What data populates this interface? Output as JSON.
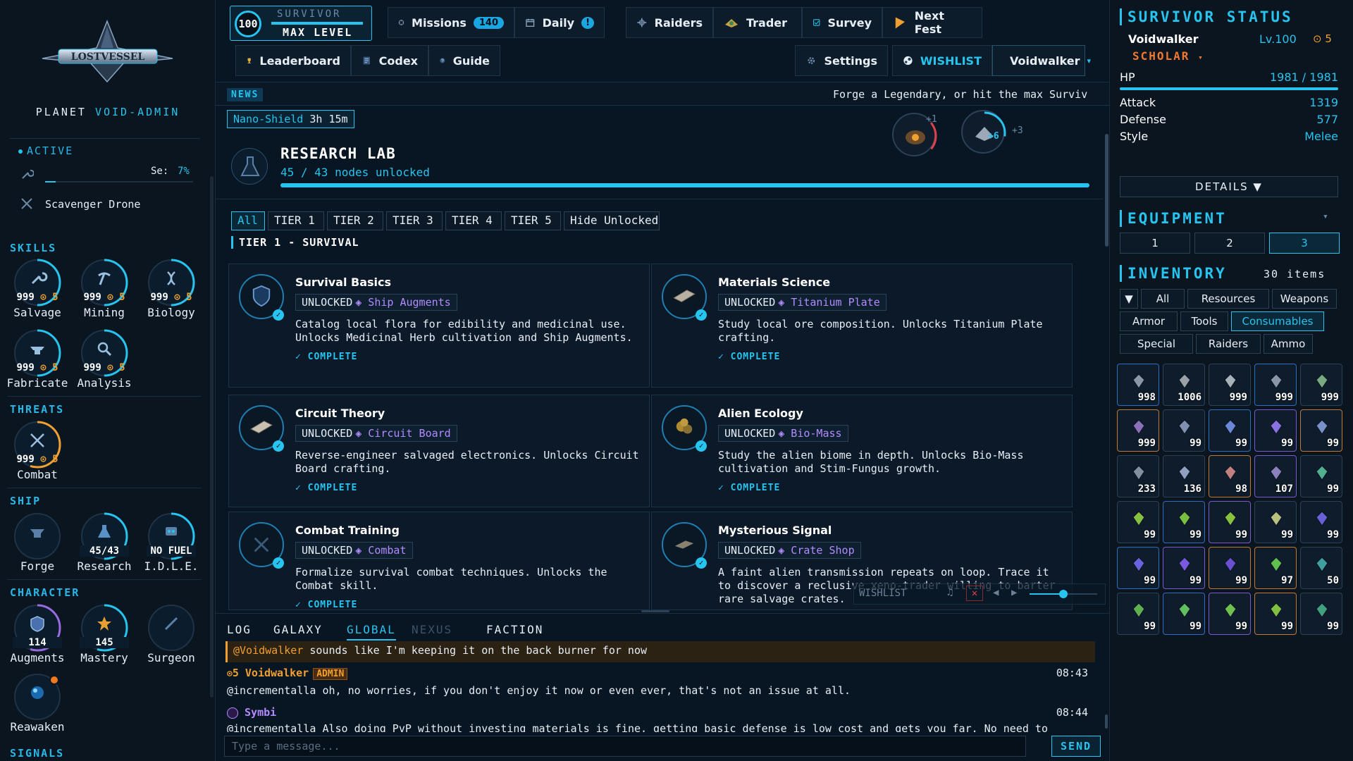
{
  "left": {
    "logo_text": "LOSTVESSEL",
    "planet_prefix": "PLANET",
    "planet_name": "VOID-ADMIN",
    "active_title": "ACTIVE",
    "active_task_label": "Se:",
    "active_task_pct": "7%",
    "active_task_progress": 0.07,
    "drone_label": "Scavenger Drone",
    "skills_title": "SKILLS",
    "skills": [
      {
        "name": "Salvage",
        "level": "999",
        "prestige": "5",
        "icon": "wrench-icon"
      },
      {
        "name": "Mining",
        "level": "999",
        "prestige": "5",
        "icon": "pickaxe-icon"
      },
      {
        "name": "Biology",
        "level": "999",
        "prestige": "5",
        "icon": "dna-icon"
      },
      {
        "name": "Fabricate",
        "level": "999",
        "prestige": "5",
        "icon": "anvil-icon"
      },
      {
        "name": "Analysis",
        "level": "999",
        "prestige": "5",
        "icon": "magnifier-icon"
      }
    ],
    "threats_title": "THREATS",
    "threats": [
      {
        "name": "Combat",
        "level": "999",
        "prestige": "5",
        "icon": "crossed-swords-icon"
      }
    ],
    "ship_title": "SHIP",
    "ship": [
      {
        "name": "Forge",
        "value": "",
        "icon": "forge-icon"
      },
      {
        "name": "Research",
        "value": "45/43",
        "icon": "flask-icon"
      },
      {
        "name": "I.D.L.E.",
        "value": "NO FUEL",
        "icon": "robot-icon"
      }
    ],
    "character_title": "CHARACTER",
    "character": [
      {
        "name": "Augments",
        "value": "114",
        "icon": "shield-chip-icon"
      },
      {
        "name": "Mastery",
        "value": "145",
        "icon": "star-badge-icon"
      },
      {
        "name": "Surgeon",
        "value": "",
        "icon": "scalpel-icon"
      },
      {
        "name": "Reawaken",
        "value": "",
        "icon": "orb-icon"
      }
    ],
    "signals_title": "SIGNALS"
  },
  "level": {
    "number": "100",
    "subtitle": "SURVIVOR",
    "title": "MAX LEVEL"
  },
  "nav": {
    "missions": "Missions",
    "missions_badge": "140",
    "daily": "Daily",
    "daily_badge": "!",
    "raiders": "Raiders",
    "trader": "Trader",
    "survey": "Survey",
    "next_fest": "Next Fest",
    "leaderboard": "Leaderboard",
    "codex": "Codex",
    "guide": "Guide",
    "settings": "Settings",
    "wishlist": "WISHLIST",
    "profile": "Voidwalker"
  },
  "news": {
    "tag": "NEWS",
    "text": "Forge a Legendary, or hit the max Surviv"
  },
  "buff": {
    "name": "Nano-Shield",
    "time": "3h 15m"
  },
  "floaters": {
    "a": "+1",
    "b": "+6",
    "c": "+3"
  },
  "lab": {
    "title": "RESEARCH LAB",
    "nodes": "45 / 43 nodes unlocked",
    "progress": 1.0
  },
  "tiers": [
    "All",
    "TIER 1",
    "TIER 2",
    "TIER 3",
    "TIER 4",
    "TIER 5",
    "Hide Unlocked"
  ],
  "tier_heading": "TIER 1 - SURVIVAL",
  "cards": [
    {
      "title": "Survival Basics",
      "unlock": "UNLOCKED",
      "reward": "Ship Augments",
      "desc": "Catalog local flora for edibility and medicinal use. Unlocks Medicinal Herb cultivation and Ship Augments.",
      "status": "✓ COMPLETE",
      "icon": "shield-icon"
    },
    {
      "title": "Materials Science",
      "unlock": "UNLOCKED",
      "reward": "Titanium Plate",
      "desc": "Study local ore composition. Unlocks Titanium Plate crafting.",
      "status": "✓ COMPLETE",
      "icon": "plate-icon"
    },
    {
      "title": "Circuit Theory",
      "unlock": "UNLOCKED",
      "reward": "Circuit Board",
      "desc": "Reverse-engineer salvaged electronics. Unlocks Circuit Board crafting.",
      "status": "✓ COMPLETE",
      "icon": "circuit-icon"
    },
    {
      "title": "Alien Ecology",
      "unlock": "UNLOCKED",
      "reward": "Bio-Mass",
      "desc": "Study the alien biome in depth. Unlocks Bio-Mass cultivation and Stim-Fungus growth.",
      "status": "✓ COMPLETE",
      "icon": "biomass-icon"
    },
    {
      "title": "Combat Training",
      "unlock": "UNLOCKED",
      "reward": "Combat",
      "desc": "Formalize survival combat techniques. Unlocks the Combat skill.",
      "status": "✓ COMPLETE",
      "icon": "crossed-swords-icon"
    },
    {
      "title": "Mysterious Signal",
      "unlock": "UNLOCKED",
      "reward": "Crate Shop",
      "desc": "A faint alien transmission repeats on loop. Trace it to discover a reclusive xeno-trader willing to barter rare salvage crates.",
      "status": "",
      "icon": "signal-icon"
    }
  ],
  "audio": {
    "label": "WISHLIST",
    "music": "♫",
    "mute": "✕",
    "prev": "◀",
    "next": "▶",
    "volume": 0.5
  },
  "chat": {
    "tabs": [
      "LOG",
      "GALAXY",
      "GLOBAL",
      "NEXUS",
      "FACTION"
    ],
    "mention_user": "@Voidwalker",
    "mention_text": " sounds like I'm keeping it on the back burner for now",
    "m2_prestige": "5",
    "m2_user": "Voidwalker",
    "m2_badge": "ADMIN",
    "m2_time": "08:43",
    "m2_text": "@incrementalla oh, no worries, if you don't enjoy it now or even ever, that's not an issue at all.",
    "m3_user": "Symbi",
    "m3_time": "08:44",
    "m3_text": "@incrementalla Also doing PvP without investing materials is fine, getting basic defense is low cost and gets you far. No need to",
    "placeholder": "Type a message...",
    "send": "SEND"
  },
  "status": {
    "title": "SURVIVOR STATUS",
    "name": "Voidwalker",
    "level": "Lv.100",
    "prestige": "5",
    "class": "SCHOLAR",
    "hp_label": "HP",
    "hp": "1981 / 1981",
    "hp_fraction": 1.0,
    "stats": [
      {
        "label": "Attack",
        "value": "1319"
      },
      {
        "label": "Defense",
        "value": "577"
      },
      {
        "label": "Style",
        "value": "Melee"
      }
    ],
    "details": "DETAILS ▼"
  },
  "equipment": {
    "title": "EQUIPMENT",
    "loadouts": [
      "1",
      "2",
      "3"
    ],
    "selected": "3"
  },
  "inventory": {
    "title": "INVENTORY",
    "count": "30 items",
    "filters": [
      "▼",
      "All",
      "Resources",
      "Weapons",
      "Armor",
      "Tools",
      "Consumables",
      "Special",
      "Raiders",
      "Ammo"
    ],
    "selected": "Consumables",
    "slots": [
      {
        "q": "998",
        "r": "rare",
        "c": "#8a96a8"
      },
      {
        "q": "1006",
        "r": "",
        "c": "#9aa0a8"
      },
      {
        "q": "999",
        "r": "",
        "c": "#a8b0b8"
      },
      {
        "q": "999",
        "r": "rare",
        "c": "#8a96a8"
      },
      {
        "q": "999",
        "r": "",
        "c": "#7aa880"
      },
      {
        "q": "999",
        "r": "leg",
        "c": "#8a70b8"
      },
      {
        "q": "99",
        "r": "",
        "c": "#8090b0"
      },
      {
        "q": "99",
        "r": "rare",
        "c": "#6a88d8"
      },
      {
        "q": "99",
        "r": "epi",
        "c": "#8a70e0"
      },
      {
        "q": "99",
        "r": "leg",
        "c": "#7a90c8"
      },
      {
        "q": "233",
        "r": "",
        "c": "#8090a0"
      },
      {
        "q": "136",
        "r": "",
        "c": "#90a0c0"
      },
      {
        "q": "98",
        "r": "leg",
        "c": "#c08080"
      },
      {
        "q": "107",
        "r": "epi",
        "c": "#8a80c0"
      },
      {
        "q": "99",
        "r": "",
        "c": "#50b090"
      },
      {
        "q": "99",
        "r": "",
        "c": "#88c040"
      },
      {
        "q": "99",
        "r": "rare",
        "c": "#7ac040"
      },
      {
        "q": "99",
        "r": "epi",
        "c": "#88c040"
      },
      {
        "q": "99",
        "r": "",
        "c": "#b8c080"
      },
      {
        "q": "99",
        "r": "",
        "c": "#6a60d8"
      },
      {
        "q": "99",
        "r": "rare",
        "c": "#6a60e0"
      },
      {
        "q": "99",
        "r": "epi",
        "c": "#7a58e0"
      },
      {
        "q": "99",
        "r": "leg",
        "c": "#6a50d0"
      },
      {
        "q": "97",
        "r": "leg",
        "c": "#60c050"
      },
      {
        "q": "50",
        "r": "",
        "c": "#40a0a0"
      },
      {
        "q": "99",
        "r": "",
        "c": "#60b050"
      },
      {
        "q": "99",
        "r": "rare",
        "c": "#60c060"
      },
      {
        "q": "99",
        "r": "epi",
        "c": "#70c050"
      },
      {
        "q": "99",
        "r": "leg",
        "c": "#80c040"
      },
      {
        "q": "99",
        "r": "",
        "c": "#40a080"
      }
    ]
  },
  "colors": {
    "accent": "#27c4ef",
    "prestige": "#f0a030",
    "epic": "#b28cff"
  }
}
